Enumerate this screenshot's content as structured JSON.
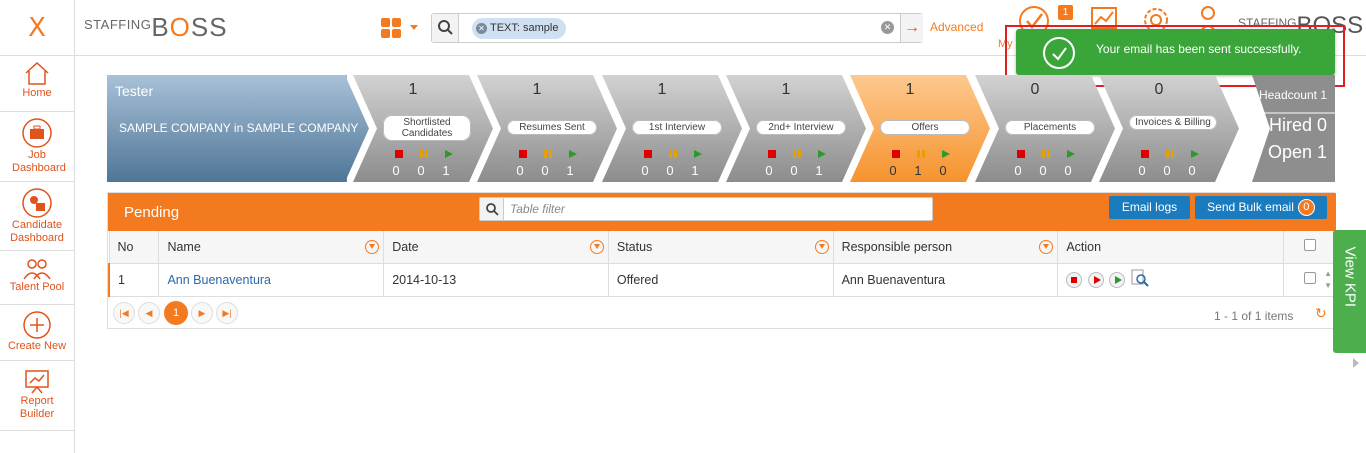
{
  "app": {
    "close_label": "X",
    "logo_small": "STAFFING",
    "logo_big_pre": "B",
    "logo_big_o": "O",
    "logo_big_post": "SS"
  },
  "search": {
    "chip_label": "TEXT: sample",
    "advanced_label": "Advanced"
  },
  "topnav": {
    "tasks_badge": "1",
    "tasks_label": "My Tasks"
  },
  "toast": {
    "message": "Your email has been sent successfully."
  },
  "sidebar": {
    "items": [
      {
        "label": "Home",
        "icon": "home-icon"
      },
      {
        "label": "Job Dashboard",
        "icon": "briefcase-icon"
      },
      {
        "label": "Candidate Dashboard",
        "icon": "candidate-icon"
      },
      {
        "label": "Talent Pool",
        "icon": "people-icon"
      },
      {
        "label": "Create New",
        "icon": "plus-circle-icon"
      },
      {
        "label": "Report Builder",
        "icon": "report-icon"
      }
    ]
  },
  "pipeline": {
    "title": "Tester",
    "company": "SAMPLE COMPANY in SAMPLE COMPANY",
    "stages": [
      {
        "count": "1",
        "label": "Shortlisted Candidates",
        "red": "0",
        "orange": "0",
        "green": "1"
      },
      {
        "count": "1",
        "label": "Resumes Sent",
        "red": "0",
        "orange": "0",
        "green": "1"
      },
      {
        "count": "1",
        "label": "1st Interview",
        "red": "0",
        "orange": "0",
        "green": "1"
      },
      {
        "count": "1",
        "label": "2nd+ Interview",
        "red": "0",
        "orange": "0",
        "green": "1"
      },
      {
        "count": "1",
        "label": "Offers",
        "red": "0",
        "orange": "1",
        "green": "0"
      },
      {
        "count": "0",
        "label": "Placements",
        "red": "0",
        "orange": "0",
        "green": "0"
      },
      {
        "count": "0",
        "label": "Invoices & Billing",
        "red": "0",
        "orange": "0",
        "green": "0"
      }
    ],
    "headcount": "Headcount 1",
    "hired": "Hired 0",
    "open": "Open 1"
  },
  "panel": {
    "title": "Pending",
    "filter_placeholder": "Table filter",
    "email_logs": "Email logs",
    "send_bulk": "Send Bulk email",
    "send_bulk_badge": "0",
    "columns": [
      "No",
      "Name",
      "Date",
      "Status",
      "Responsible person",
      "Action"
    ],
    "rows": [
      {
        "no": "1",
        "name": "Ann Buenaventura",
        "date": "2014-10-13",
        "status": "Offered",
        "responsible": "Ann Buenaventura"
      }
    ],
    "page": "1",
    "page_info": "1 - 1 of 1 items"
  },
  "kpi": {
    "label": "View KPI"
  },
  "colors": {
    "accent": "#f47a20",
    "blue_button": "#1a7bbf",
    "success": "#3aa63a",
    "pipeline_gray": "#a6a6a6",
    "pipeline_active": "#f9a24a"
  }
}
